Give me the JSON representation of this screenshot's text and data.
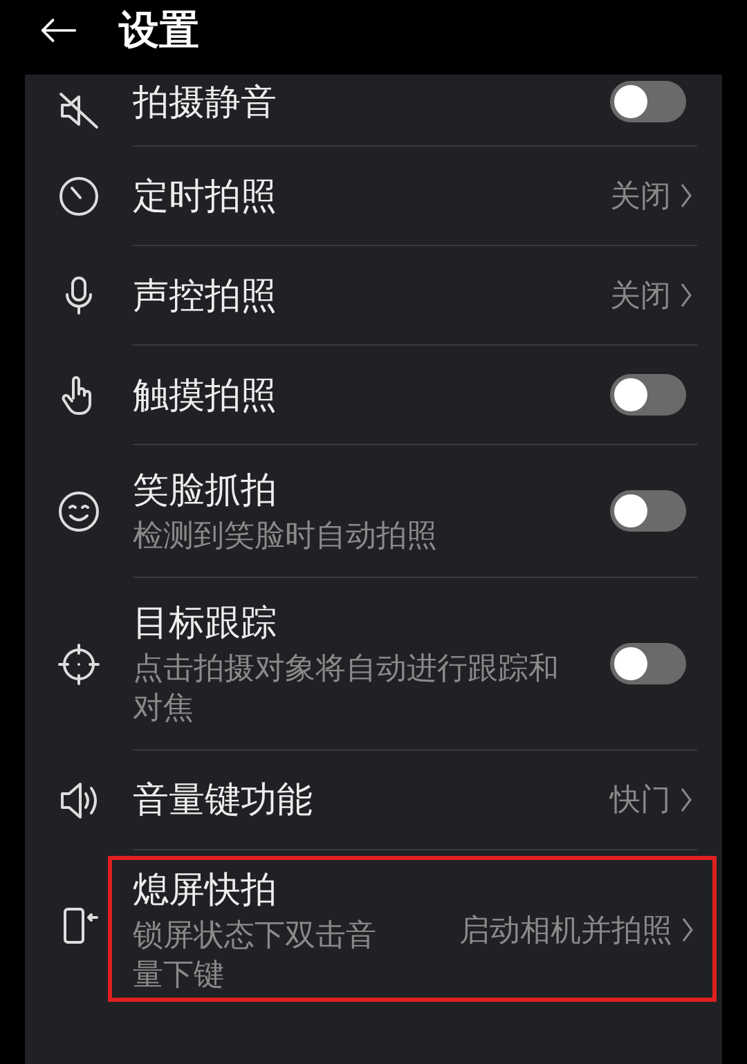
{
  "header": {
    "title": "设置"
  },
  "settings": [
    {
      "kind": "toggle",
      "title": "拍摄静音",
      "on": false
    },
    {
      "kind": "link",
      "title": "定时拍照",
      "value": "关闭"
    },
    {
      "kind": "link",
      "title": "声控拍照",
      "value": "关闭"
    },
    {
      "kind": "toggle",
      "title": "触摸拍照",
      "on": false
    },
    {
      "kind": "toggle",
      "title": "笑脸抓拍",
      "subtitle": "检测到笑脸时自动拍照",
      "on": false
    },
    {
      "kind": "toggle",
      "title": "目标跟踪",
      "subtitle": "点击拍摄对象将自动进行跟踪和对焦",
      "on": false
    },
    {
      "kind": "link",
      "title": "音量键功能",
      "value": "快门"
    },
    {
      "kind": "link",
      "title": "熄屏快拍",
      "subtitle": "锁屏状态下双击音量下键",
      "value": "启动相机并拍照",
      "highlighted": true
    }
  ]
}
